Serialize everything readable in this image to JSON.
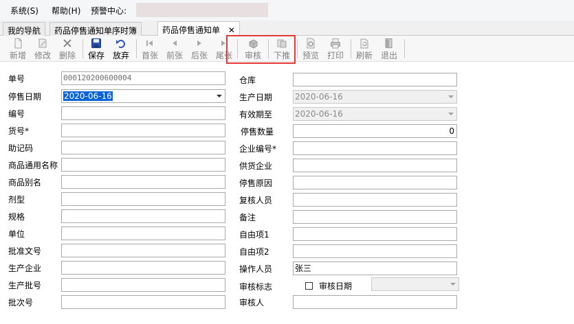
{
  "menu": {
    "system": "系统(S)",
    "help": "帮助(H)",
    "alert_center": "预警中心:"
  },
  "tabs": {
    "nav": "我的导航",
    "list": "药品停售通知单序时簿",
    "form": "药品停售通知单"
  },
  "toolbar": {
    "new": "新增",
    "edit": "修改",
    "delete": "删除",
    "save": "保存",
    "discard": "放弃",
    "first": "首张",
    "prev": "前张",
    "next": "后张",
    "last": "尾张",
    "audit": "审核",
    "push": "下推",
    "preview": "预览",
    "print": "打印",
    "refresh": "刷新",
    "exit": "退出"
  },
  "form": {
    "bill_no": {
      "label": "单号",
      "value": "000120200600004"
    },
    "stop_date": {
      "label": "停售日期",
      "value": "2020-06-16"
    },
    "code": {
      "label": "编号",
      "value": ""
    },
    "item_no": {
      "label": "货号*",
      "value": ""
    },
    "mnemonic": {
      "label": "助记码",
      "value": ""
    },
    "generic_name": {
      "label": "商品通用名称",
      "value": ""
    },
    "alias": {
      "label": "商品别名",
      "value": ""
    },
    "dosage_form": {
      "label": "剂型",
      "value": ""
    },
    "spec": {
      "label": "规格",
      "value": ""
    },
    "unit": {
      "label": "单位",
      "value": ""
    },
    "approval_no": {
      "label": "批准文号",
      "value": ""
    },
    "manufacturer": {
      "label": "生产企业",
      "value": ""
    },
    "prod_batch": {
      "label": "生产批号",
      "value": ""
    },
    "lot_no": {
      "label": "批次号",
      "value": ""
    },
    "warehouse": {
      "label": "仓库",
      "value": ""
    },
    "prod_date": {
      "label": "生产日期",
      "value": "2020-06-16"
    },
    "expiry": {
      "label": "有效期至",
      "value": "2020-06-16"
    },
    "stop_qty": {
      "label": "停售数量",
      "value": "0"
    },
    "company_no": {
      "label": "企业编号*",
      "value": ""
    },
    "supplier": {
      "label": "供货企业",
      "value": ""
    },
    "reason": {
      "label": "停售原因",
      "value": ""
    },
    "reviewer": {
      "label": "复核人员",
      "value": ""
    },
    "remark": {
      "label": "备注",
      "value": ""
    },
    "free1": {
      "label": "自由项1",
      "value": ""
    },
    "free2": {
      "label": "自由项2",
      "value": ""
    },
    "operator": {
      "label": "操作人员",
      "value": "张三"
    },
    "audit_flag": {
      "label": "审核标志"
    },
    "audit_date": {
      "label": "审核日期",
      "value": ""
    },
    "auditor": {
      "label": "审核人",
      "value": ""
    }
  },
  "colors": {
    "highlight": "#e53935",
    "selection": "#0a64d7"
  }
}
